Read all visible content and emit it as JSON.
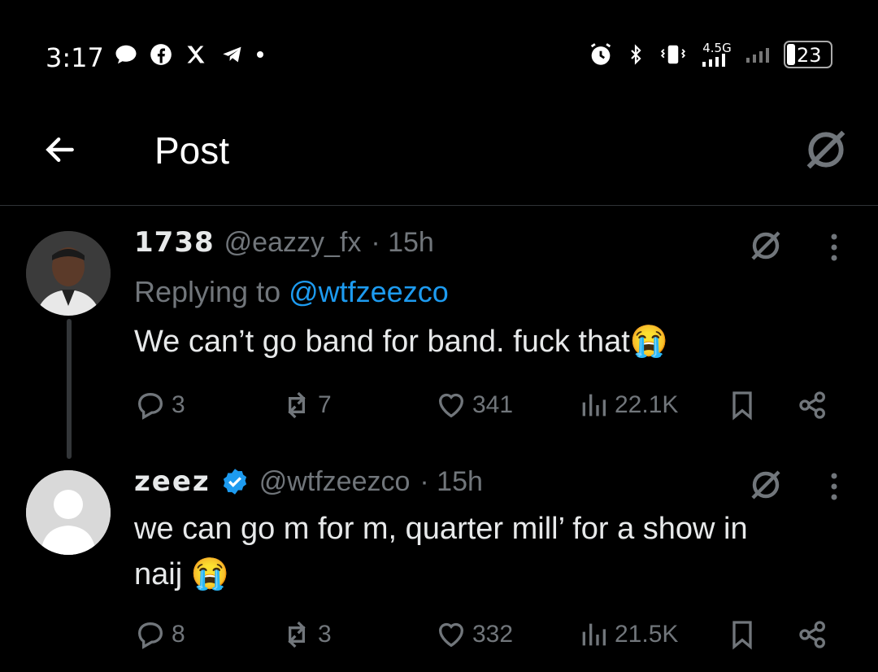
{
  "status_bar": {
    "time": "3:17",
    "network": "4.5G",
    "battery": "23"
  },
  "header": {
    "title": "Post"
  },
  "tweets": [
    {
      "name": "1738",
      "handle": "@eazzy_fx",
      "time": "· 15h",
      "replying_prefix": "Replying to ",
      "replying_to": "@wtfzeezco",
      "text": "We can’t go band for band. fuck that😭",
      "replies": "3",
      "reposts": "7",
      "likes": "341",
      "views": "22.1K"
    },
    {
      "name": "zeez",
      "handle": "@wtfzeezco",
      "time": "· 15h",
      "text_line1": "we can go m for m, quarter mill’ for a show in",
      "text_line2": "naij 😭",
      "replies": "8",
      "reposts": "3",
      "likes": "332",
      "views": "21.5K",
      "verified_color": "#1d9bf0"
    }
  ]
}
